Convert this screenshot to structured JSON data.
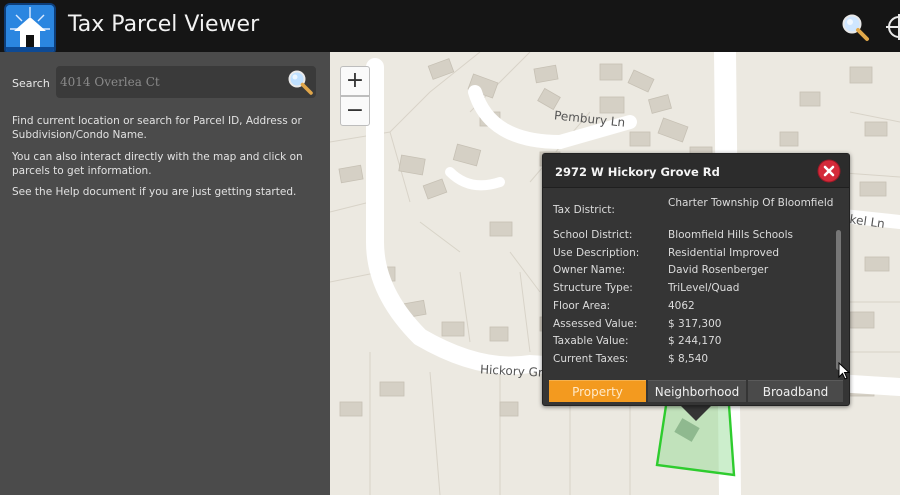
{
  "header": {
    "title": "Tax Parcel Viewer",
    "logo_icon": "house-compass-logo",
    "search_icon": "magnifier-icon",
    "locate_icon": "target-icon"
  },
  "sidebar": {
    "search_label": "Search",
    "search_placeholder": "4014 Overlea Ct",
    "help_lines": [
      "Find current location or search for Parcel ID, Address or Subdivision/Condo Name.",
      "You can also interact directly with the map and click on parcels to get information.",
      "See the Help document if you are just getting started."
    ]
  },
  "map": {
    "zoom_in": "+",
    "zoom_out": "−",
    "road_labels": [
      "Pembury Ln",
      "Hickory Gr",
      "nkel Ln"
    ],
    "parcel_highlight_color": "#3ecf3e"
  },
  "popup": {
    "title": "2972 W Hickory Grove Rd",
    "fields": [
      {
        "label": "Tax District:",
        "value": "Charter Township Of Bloomfield"
      },
      {
        "label": "School District:",
        "value": "Bloomfield Hills Schools"
      },
      {
        "label": "Use Description:",
        "value": "Residential Improved"
      },
      {
        "label": "Owner Name:",
        "value": "David Rosenberger"
      },
      {
        "label": "Structure Type:",
        "value": "TriLevel/Quad"
      },
      {
        "label": "Floor Area:",
        "value": "4062"
      },
      {
        "label": "Assessed Value:",
        "value": "$ 317,300"
      },
      {
        "label": "Taxable Value:",
        "value": "$ 244,170"
      },
      {
        "label": "Current Taxes:",
        "value": "$ 8,540"
      }
    ],
    "tabs": [
      "Property",
      "Neighborhood",
      "Broadband"
    ],
    "active_tab": "Property",
    "accent_color": "#f39a1f"
  }
}
